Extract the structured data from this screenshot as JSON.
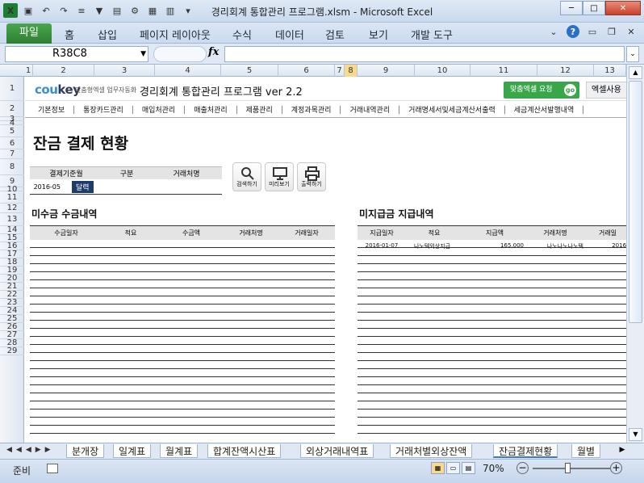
{
  "window": {
    "title": "경리회계 통합관리 프로그램.xlsm - Microsoft Excel",
    "controls": [
      "─",
      "□",
      "✕"
    ]
  },
  "ribbon": {
    "file_tab": "파일",
    "tabs": [
      "홈",
      "삽입",
      "페이지 레이아웃",
      "수식",
      "데이터",
      "검토",
      "보기",
      "개발 도구"
    ]
  },
  "formula_bar": {
    "name_box": "R38C8",
    "fx": "fx",
    "formula": ""
  },
  "columns": [
    "1",
    "2",
    "3",
    "4",
    "5",
    "6",
    "7",
    "8",
    "9",
    "10",
    "11",
    "12",
    "13"
  ],
  "selected_column": "8",
  "rows": [
    "1",
    "2",
    "3",
    "4",
    "5",
    "6",
    "7",
    "8",
    "9",
    "10",
    "11",
    "12",
    "13",
    "14",
    "15",
    "16",
    "17",
    "18",
    "19",
    "20",
    "21",
    "22",
    "23",
    "24",
    "25",
    "26",
    "27",
    "28",
    "29"
  ],
  "brand": {
    "logo_co": "cou",
    "logo_key": "key",
    "logo_sub": "맞춤형엑셀 업무자동화",
    "app_title": "경리회계 통합관리 프로그램 ver 2.2",
    "request_button": "맞춤엑셀 요청",
    "go": "go",
    "excel_button": "엑셀사용"
  },
  "menu": [
    "기본정보",
    "통장카드관리",
    "매입처관리",
    "매출처관리",
    "제품관리",
    "계정과목관리",
    "거래내역관리",
    "거래명세서및세금계산서출력",
    "세금계산서발행내역"
  ],
  "page": {
    "title": "잔금 결제 현황"
  },
  "filter": {
    "headers": [
      "결제기준월",
      "구분",
      "거래처명"
    ],
    "month_value": "2016-05",
    "calendar_button": "달력"
  },
  "actions": {
    "search": "검색하기",
    "preview": "미리보기",
    "print": "출력하기"
  },
  "receivable": {
    "title": "미수금 수금내역",
    "headers": [
      "수금일자",
      "적요",
      "수금액",
      "거래처명",
      "거래일자"
    ]
  },
  "payable": {
    "title": "미지급금 지급내역",
    "headers": [
      "지급일자",
      "적요",
      "지급액",
      "거래처명",
      "거래일"
    ],
    "rows": [
      {
        "date": "2016-01-07",
        "memo": "나노텍외상지급",
        "amount": "165,000",
        "client": "나노나노나노텍",
        "trade_date": "2016-0"
      }
    ]
  },
  "sheet_tabs": [
    "분개장",
    "일계표",
    "월계표",
    "합계잔액시산표",
    "외상거래내역표",
    "거래처별외상잔액",
    "잔금결제현황",
    "월별"
  ],
  "active_sheet": "잔금결제현황",
  "status": {
    "ready": "준비",
    "zoom": "70%",
    "zoom_level": 0.45
  }
}
